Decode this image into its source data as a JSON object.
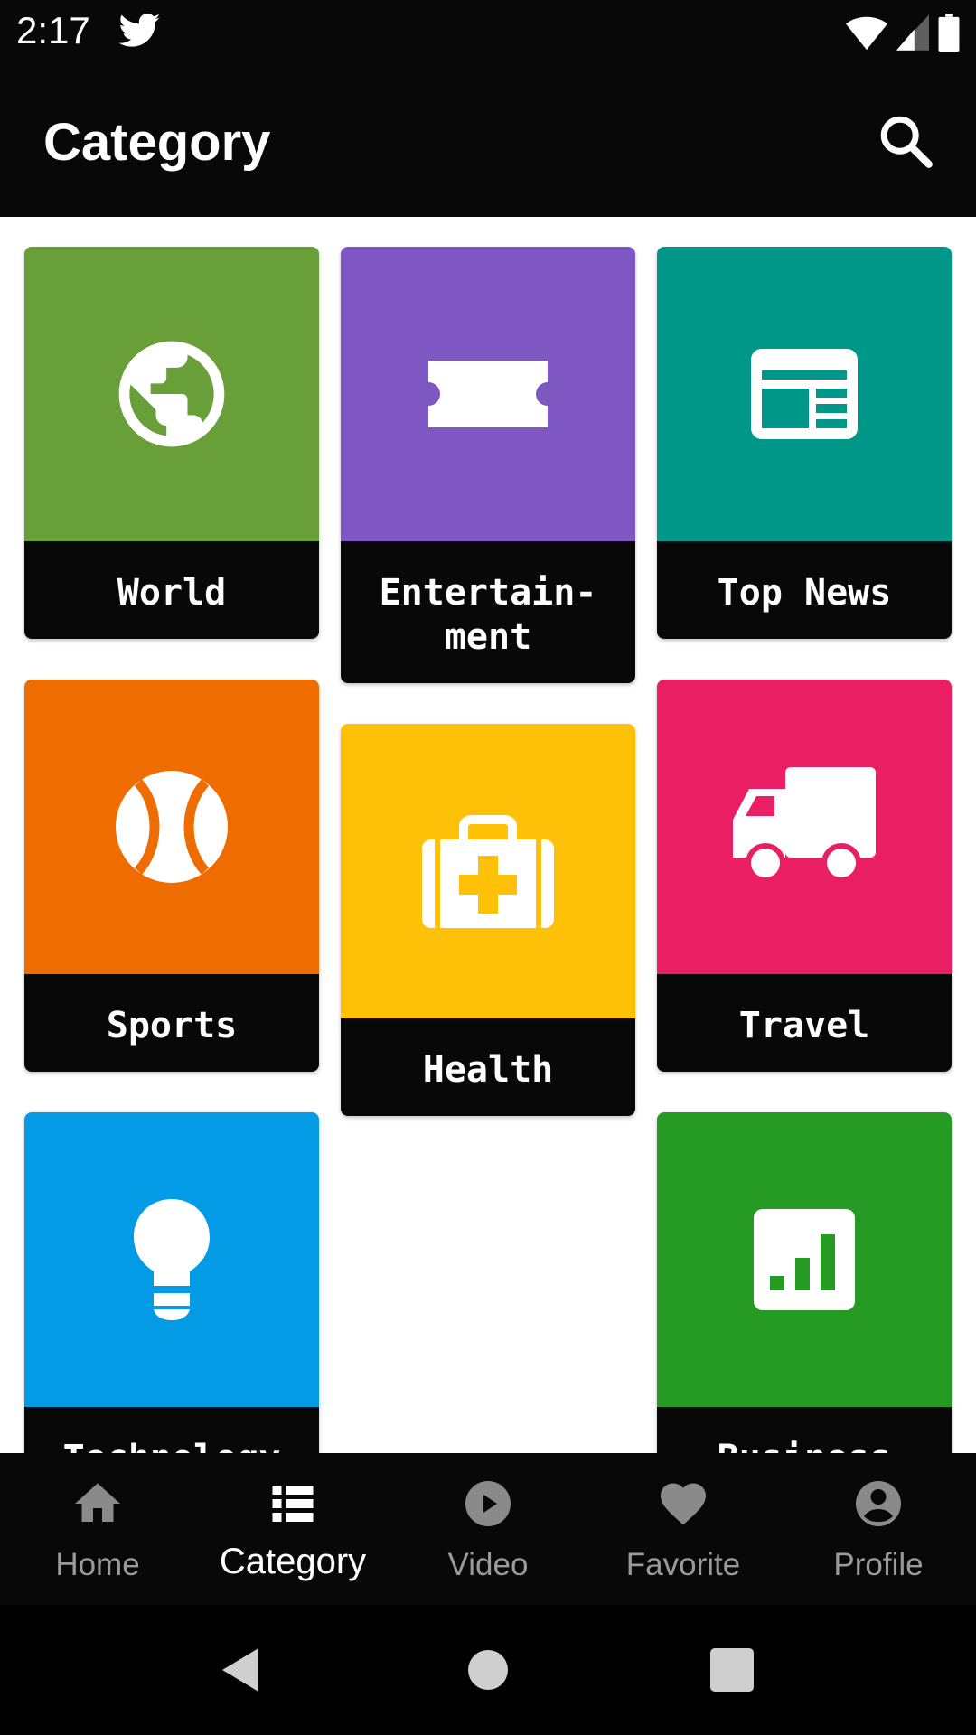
{
  "status_bar": {
    "time": "2:17"
  },
  "app_bar": {
    "title": "Category"
  },
  "categories": [
    {
      "label": "World",
      "color": "#689F38",
      "icon": "globe-icon"
    },
    {
      "label": "Entertain-\nment",
      "color": "#7E57C2",
      "icon": "ticket-icon"
    },
    {
      "label": "Top News",
      "color": "#009688",
      "icon": "newspaper-icon"
    },
    {
      "label": "Sports",
      "color": "#EF6C00",
      "icon": "ball-icon"
    },
    {
      "label": "Health",
      "color": "#FFC107",
      "icon": "medical-bag-icon"
    },
    {
      "label": "Travel",
      "color": "#E91E63",
      "icon": "truck-icon"
    },
    {
      "label": "Technology",
      "color": "#039BE5",
      "icon": "lightbulb-icon"
    },
    {
      "label": "Business",
      "color": "#259B24",
      "icon": "chart-icon"
    }
  ],
  "bottom_nav": [
    {
      "label": "Home",
      "icon": "home-icon",
      "active": false
    },
    {
      "label": "Category",
      "icon": "list-icon",
      "active": true
    },
    {
      "label": "Video",
      "icon": "play-circle-icon",
      "active": false
    },
    {
      "label": "Favorite",
      "icon": "heart-icon",
      "active": false
    },
    {
      "label": "Profile",
      "icon": "account-circle-icon",
      "active": false
    }
  ]
}
